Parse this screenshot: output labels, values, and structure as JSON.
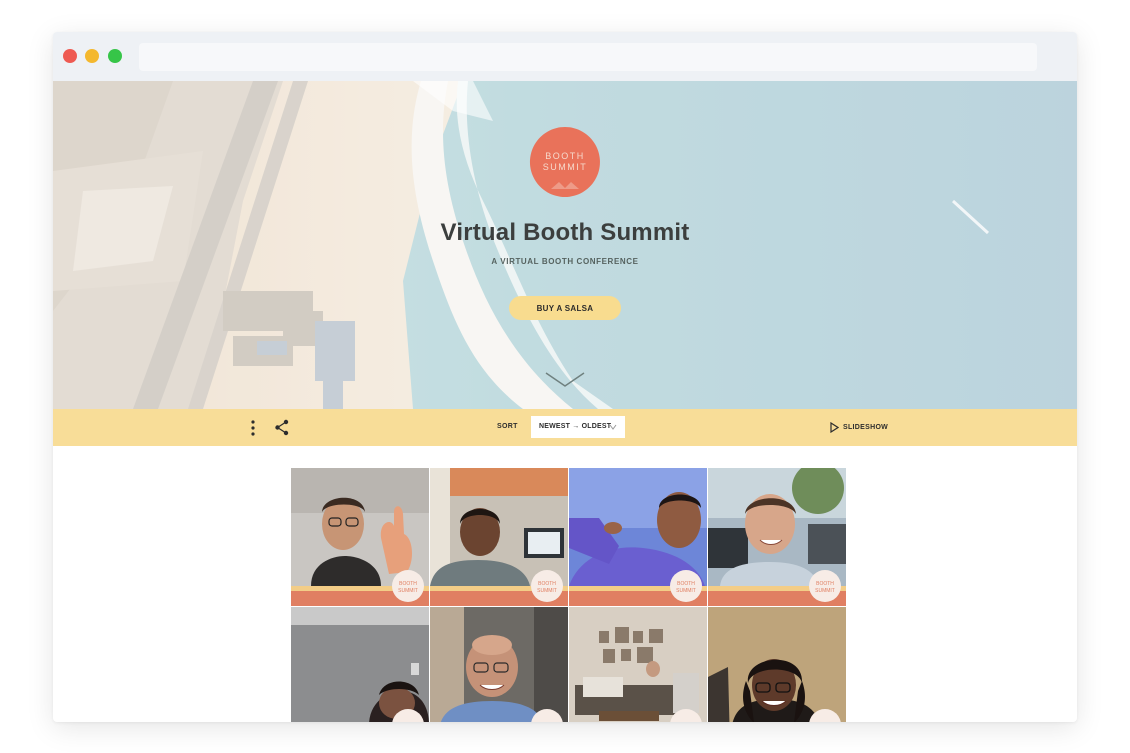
{
  "hero": {
    "title": "Virtual Booth Summit",
    "subtitle": "A VIRTUAL BOOTH CONFERENCE",
    "cta_label": "BUY A SALSA",
    "logo_text": [
      "BOOTH",
      "SUMMIT"
    ]
  },
  "toolbar": {
    "sort_label": "SORT",
    "sort_value": "NEWEST → OLDEST",
    "slideshow_label": "SLIDESHOW"
  },
  "icons": {
    "more": "more-vertical-icon",
    "share": "share-icon",
    "scroll": "chevron-down-icon",
    "sort": "chevron-down-icon",
    "slideshow": "play-icon"
  },
  "colors": {
    "brand": "#e9725a",
    "toolbar_bg": "#f8dd98",
    "button_bg": "#f8dc8f",
    "strip_coral": "#e07f62",
    "strip_yellow": "#f3cd87"
  },
  "gallery": {
    "badge_text": [
      "BOOTH",
      "SUMMIT"
    ]
  }
}
